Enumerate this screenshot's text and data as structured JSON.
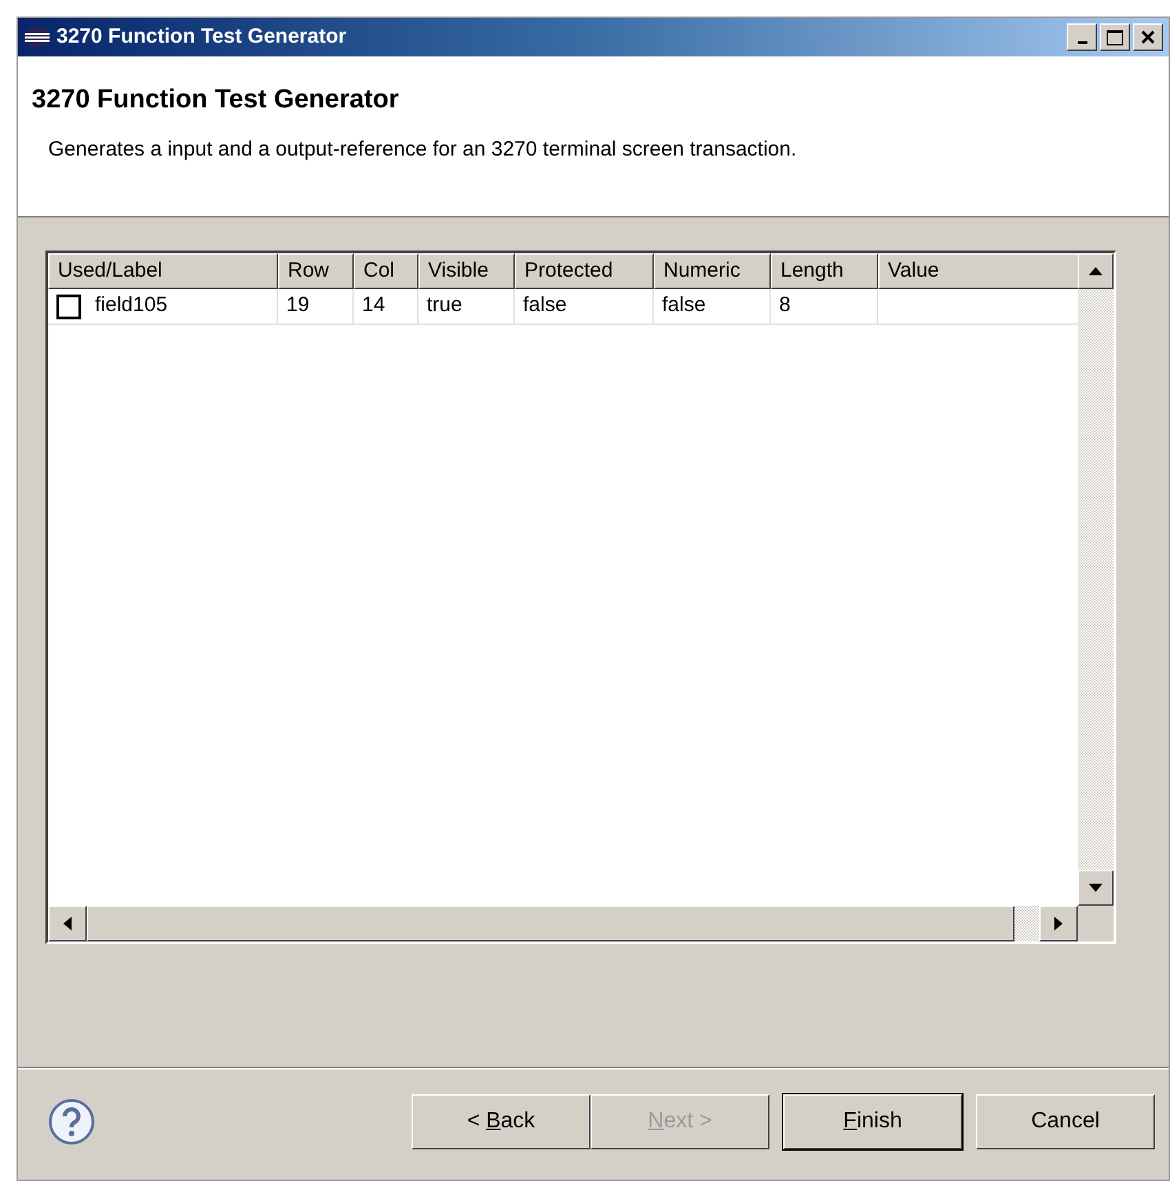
{
  "window": {
    "title": "3270 Function Test Generator"
  },
  "header": {
    "title": "3270 Function Test Generator",
    "description": "Generates a input and a output-reference for an 3270 terminal screen transaction."
  },
  "table": {
    "columns": [
      "Used/Label",
      "Row",
      "Col",
      "Visible",
      "Protected",
      "Numeric",
      "Length",
      "Value"
    ],
    "rows": [
      {
        "checked": false,
        "cells": [
          "field105",
          "19",
          "14",
          "true",
          "false",
          "false",
          "8",
          ""
        ]
      }
    ]
  },
  "buttons": [
    {
      "before": "< ",
      "mnemonic": "B",
      "after": "ack",
      "disabled": false,
      "default": false
    },
    {
      "mnemonic": "N",
      "after": "ext >",
      "disabled": true,
      "default": false
    },
    {
      "mnemonic": "F",
      "after": "inish",
      "disabled": false,
      "default": true
    },
    {
      "label": "Cancel",
      "disabled": false,
      "default": false
    }
  ]
}
